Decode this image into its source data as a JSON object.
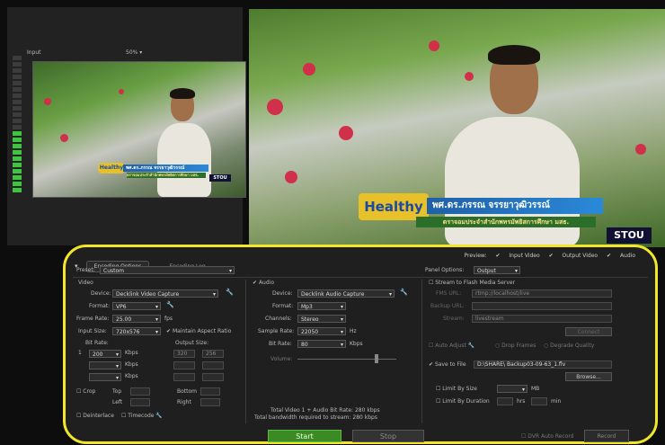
{
  "input_panel": {
    "label": "Input",
    "zoom": "50%"
  },
  "meter": {
    "levels": 22,
    "active_from": 12
  },
  "overlay": {
    "logo": "Healthy",
    "name_line": "พศ.ดร.ภรรณ จรรยาวุฒิวรรณ์",
    "sub_line": "ตราจอมประจำสำนักพทรมัพยิสการศึกษา มสธ.",
    "brand": "STOU"
  },
  "tabs": {
    "encoding_options": "Encoding Options",
    "encoding_log": "Encoding Log"
  },
  "preview_opts": {
    "label": "Preview:",
    "input_video": "Input Video",
    "output_video": "Output Video",
    "audio": "Audio"
  },
  "preset": {
    "label": "Preset:",
    "value": "Custom"
  },
  "panel_options": {
    "label": "Panel Options:",
    "value": "Output"
  },
  "video": {
    "title": "Video",
    "device_label": "Device:",
    "device": "Decklink Video Capture",
    "format_label": "Format:",
    "format": "VP6",
    "frame_rate_label": "Frame Rate:",
    "frame_rate": "25.00",
    "fps": "fps",
    "input_size_label": "Input Size:",
    "input_size": "720x576",
    "maintain_aspect": "Maintain Aspect Ratio",
    "bit_rate_label": "Bit Rate:",
    "output_size_label": "Output Size:",
    "rows": [
      {
        "num": "1",
        "bitrate": "200",
        "kbps": "Kbps",
        "w": "320",
        "h": "256"
      },
      {
        "num": "",
        "bitrate": "",
        "kbps": "Kbps",
        "w": "",
        "h": ""
      },
      {
        "num": "",
        "bitrate": "",
        "kbps": "Kbps",
        "w": "",
        "h": ""
      }
    ],
    "crop_label": "Crop",
    "top": "Top",
    "bottom": "Bottom",
    "left": "Left",
    "right": "Right",
    "deinterlace": "Deinterlace",
    "timecode": "Timecode"
  },
  "audio": {
    "title": "Audio",
    "device_label": "Device:",
    "device": "Decklink Audio Capture",
    "format_label": "Format:",
    "format": "Mp3",
    "channels_label": "Channels:",
    "channels": "Stereo",
    "sample_rate_label": "Sample Rate:",
    "sample_rate": "22050",
    "hz": "Hz",
    "bit_rate_label": "Bit Rate:",
    "bit_rate": "80",
    "kbps": "Kbps",
    "volume_label": "Volume:"
  },
  "totals": {
    "line1": "Total Video 1 + Audio Bit Rate:  280 kbps",
    "line2": "Total bandwidth required to stream:  280 kbps"
  },
  "output": {
    "stream_label": "Stream to Flash Media Server",
    "fms_url_label": "FMS URL:",
    "fms_url": "rtmp://localhost/live",
    "backup_label": "Backup URL:",
    "stream_name_label": "Stream:",
    "stream_name": "livestream",
    "connect": "Connect",
    "auto_adjust": "Auto Adjust",
    "drop_frames": "Drop Frames",
    "degrade_quality": "Degrade Quality",
    "save_label": "Save to File",
    "save_path": "D:\\SHARE\\ Backup03-09-63_1.flv",
    "browse": "Browse...",
    "limit_size": "Limit By Size",
    "mb": "MB",
    "limit_duration": "Limit By Duration",
    "hrs": "hrs",
    "min": "min"
  },
  "footer": {
    "start": "Start",
    "stop": "Stop",
    "dvr": "DVR Auto Record",
    "record": "Record"
  }
}
